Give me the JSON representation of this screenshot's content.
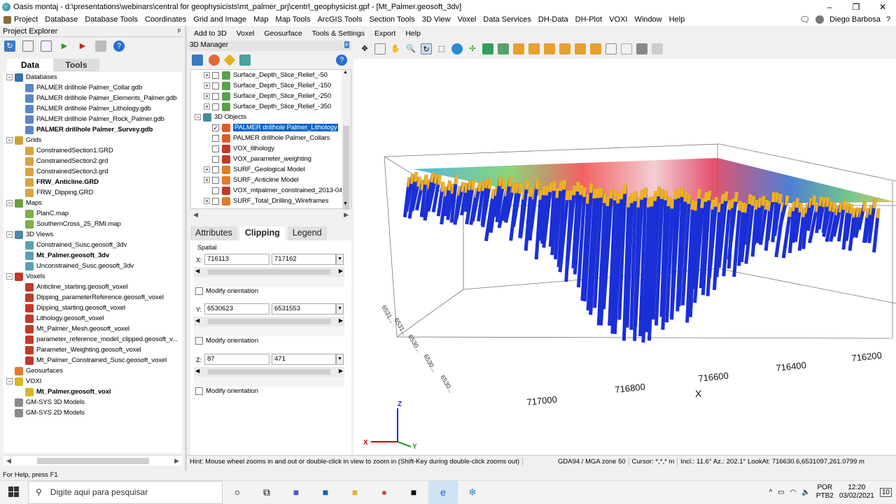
{
  "window": {
    "title": "Oasis montaj - d:\\presentations\\webinars\\central for geophysicists\\mt_palmer_prj\\centrl_geophysicist.gpf - [Mt_Palmer.geosoft_3dv]",
    "controls": [
      "–",
      "❐",
      "✕"
    ]
  },
  "menu": {
    "items": [
      "Project",
      "Database",
      "Database Tools",
      "Coordinates",
      "Grid and Image",
      "Map",
      "Map Tools",
      "ArcGIS Tools",
      "Section Tools",
      "3D View",
      "Voxel",
      "Data Services",
      "DH-Data",
      "DH-Plot",
      "VOXI",
      "Window",
      "Help"
    ],
    "user": "Diego Barbosa"
  },
  "project_explorer": {
    "title": "Project Explorer",
    "pin": "ᵖ",
    "tabs": [
      "Data",
      "Tools"
    ],
    "tree": [
      {
        "label": "Databases",
        "level": 0,
        "expander": "−",
        "bold": false,
        "icon": "database-folder-icon",
        "color": "#3a6fb0"
      },
      {
        "label": "PALMER drillhole Palmer_Collar.gdb",
        "level": 1,
        "bold": false,
        "icon": "database-icon",
        "color": "#5b87c7"
      },
      {
        "label": "PALMER drillhole Palmer_Elements_Palmer.gdb",
        "level": 1,
        "bold": false,
        "icon": "database-icon",
        "color": "#5b87c7"
      },
      {
        "label": "PALMER drillhole Palmer_Lithology.gdb",
        "level": 1,
        "bold": false,
        "icon": "database-icon",
        "color": "#5b87c7"
      },
      {
        "label": "PALMER drillhole Palmer_Rock_Palmer.gdb",
        "level": 1,
        "bold": false,
        "icon": "database-icon",
        "color": "#5b87c7"
      },
      {
        "label": "PALMER drillhole Palmer_Survey.gdb",
        "level": 1,
        "bold": true,
        "icon": "database-icon",
        "color": "#5b87c7"
      },
      {
        "label": "Grids",
        "level": 0,
        "expander": "−",
        "bold": false,
        "icon": "grid-folder-icon",
        "color": "#c8a23a"
      },
      {
        "label": "ConstrainedSection1.GRD",
        "level": 1,
        "bold": false,
        "icon": "grid-icon",
        "color": "#d9a441"
      },
      {
        "label": "ConstrainedSection2.grd",
        "level": 1,
        "bold": false,
        "icon": "grid-icon",
        "color": "#d9a441"
      },
      {
        "label": "ConstrainedSection3.grd",
        "level": 1,
        "bold": false,
        "icon": "grid-icon",
        "color": "#d9a441"
      },
      {
        "label": "FRW_Anticline.GRD",
        "level": 1,
        "bold": true,
        "icon": "grid-icon",
        "color": "#d9a441"
      },
      {
        "label": "FRW_Dipping.GRD",
        "level": 1,
        "bold": false,
        "icon": "grid-icon",
        "color": "#d9a441"
      },
      {
        "label": "Maps",
        "level": 0,
        "expander": "−",
        "bold": false,
        "icon": "map-folder-icon",
        "color": "#6a9f3a"
      },
      {
        "label": "PlanC.map",
        "level": 1,
        "bold": false,
        "icon": "map-icon",
        "color": "#7fae4a"
      },
      {
        "label": "SouthernCross_25_RMI.map",
        "level": 1,
        "bold": false,
        "icon": "map-icon",
        "color": "#7fae4a"
      },
      {
        "label": "3D Views",
        "level": 0,
        "expander": "−",
        "bold": false,
        "icon": "3d-view-folder-icon",
        "color": "#4a8aa0"
      },
      {
        "label": "Constrained_Susc.geosoft_3dv",
        "level": 1,
        "bold": false,
        "icon": "3d-view-icon",
        "color": "#5aa0b5"
      },
      {
        "label": "Mt_Palmer.geosoft_3dv",
        "level": 1,
        "bold": true,
        "icon": "3d-view-icon",
        "color": "#5aa0b5"
      },
      {
        "label": "Unconstrained_Susc.geosoft_3dv",
        "level": 1,
        "bold": false,
        "icon": "3d-view-icon",
        "color": "#5aa0b5"
      },
      {
        "label": "Voxels",
        "level": 0,
        "expander": "−",
        "bold": false,
        "icon": "voxel-folder-icon",
        "color": "#c0392b"
      },
      {
        "label": "Anticline_starting.geosoft_voxel",
        "level": 1,
        "bold": false,
        "icon": "voxel-icon",
        "color": "#c0392b"
      },
      {
        "label": "Dipping_parameterReference.geosoft_voxel",
        "level": 1,
        "bold": false,
        "icon": "voxel-icon",
        "color": "#c0392b"
      },
      {
        "label": "Dipping_starting.geosoft_voxel",
        "level": 1,
        "bold": false,
        "icon": "voxel-icon",
        "color": "#c0392b"
      },
      {
        "label": "Lithology.geosoft_voxel",
        "level": 1,
        "bold": false,
        "icon": "voxel-icon",
        "color": "#c0392b"
      },
      {
        "label": "Mt_Palmer_Mesh.geosoft_voxel",
        "level": 1,
        "bold": false,
        "icon": "voxel-icon",
        "color": "#c0392b"
      },
      {
        "label": "parameter_reference_model_clipped.geosoft_v...",
        "level": 1,
        "bold": false,
        "icon": "voxel-icon",
        "color": "#c0392b"
      },
      {
        "label": "Parameter_Weighting.geosoft_voxel",
        "level": 1,
        "bold": false,
        "icon": "voxel-icon",
        "color": "#c0392b"
      },
      {
        "label": "Mt_Palmer_Constrained_Susc.geosoft_voxel",
        "level": 1,
        "bold": false,
        "icon": "voxel-icon",
        "color": "#c0392b"
      },
      {
        "label": "Geosurfaces",
        "level": 0,
        "bold": false,
        "icon": "geosurface-icon",
        "color": "#e07b28"
      },
      {
        "label": "VOXI",
        "level": 0,
        "expander": "−",
        "bold": false,
        "icon": "voxi-folder-icon",
        "color": "#d4b820"
      },
      {
        "label": "Mt_Palmer.geosoft_voxi",
        "level": 1,
        "bold": true,
        "icon": "voxi-icon",
        "color": "#d4b820"
      },
      {
        "label": "GM-SYS 3D Models",
        "level": 0,
        "bold": false,
        "icon": "gmsys-3d-icon",
        "color": "#8a8a8a"
      },
      {
        "label": "GM-SYS 2D Models",
        "level": 0,
        "bold": false,
        "icon": "gmsys-2d-icon",
        "color": "#8a8a8a"
      }
    ],
    "hscroll_left": "◀",
    "hscroll_right": "▶"
  },
  "top_toolbar": {
    "items": [
      "Add to 3D",
      "Voxel",
      "Geosurface",
      "Tools & Settings",
      "Export",
      "Help"
    ]
  },
  "manager_3d": {
    "title": "3D Manager",
    "pin": "ᵖ",
    "tree": [
      {
        "label": "Surface_Depth_Slice_Relief_-50",
        "level": 1,
        "expander": "+",
        "checked": false,
        "selected": false,
        "icon": "surface-icon",
        "color": "#5aa04a"
      },
      {
        "label": "Surface_Depth_Slice_Relief_-150",
        "level": 1,
        "expander": "+",
        "checked": false,
        "selected": false,
        "icon": "surface-icon",
        "color": "#5aa04a"
      },
      {
        "label": "Surface_Depth_Slice_Relief_-250",
        "level": 1,
        "expander": "+",
        "checked": false,
        "selected": false,
        "icon": "surface-icon",
        "color": "#5aa04a"
      },
      {
        "label": "Surface_Depth_Slice_Relief_-350",
        "level": 1,
        "expander": "+",
        "checked": false,
        "selected": false,
        "icon": "surface-icon",
        "color": "#5aa04a"
      },
      {
        "label": "3D Objects",
        "level": 0,
        "expander": "−",
        "checked": null,
        "selected": false,
        "icon": "3d-objects-icon",
        "color": "#4a8aa0"
      },
      {
        "label": "PALMER drillhole Palmer_Lithology",
        "level": 1,
        "checked": true,
        "selected": true,
        "icon": "drillhole-icon",
        "color": "#e05a2a"
      },
      {
        "label": "PALMER drillhole Palmer_Collars",
        "level": 1,
        "checked": false,
        "selected": false,
        "icon": "drillhole-icon",
        "color": "#e05a2a"
      },
      {
        "label": "VOX_lithology",
        "level": 1,
        "checked": false,
        "selected": false,
        "icon": "voxel-icon",
        "color": "#c0392b"
      },
      {
        "label": "VOX_parameter_weighting",
        "level": 1,
        "checked": false,
        "selected": false,
        "icon": "voxel-icon",
        "color": "#c0392b"
      },
      {
        "label": "SURF_Geological Model",
        "level": 1,
        "expander": "+",
        "checked": false,
        "selected": false,
        "icon": "geosurface-icon",
        "color": "#e07b28"
      },
      {
        "label": "SURF_Anticline Model",
        "level": 1,
        "expander": "+",
        "checked": false,
        "selected": false,
        "icon": "geosurface-icon",
        "color": "#e07b28"
      },
      {
        "label": "VOX_mtpalmer_constrained_2013-04-2",
        "level": 1,
        "checked": false,
        "selected": false,
        "icon": "voxel-icon",
        "color": "#c0392b"
      },
      {
        "label": "SURF_Total_Drilling_Wireframes",
        "level": 1,
        "expander": "+",
        "checked": false,
        "selected": false,
        "icon": "geosurface-icon",
        "color": "#e07b28"
      }
    ],
    "scroll_up": "▲",
    "scroll_down": "▼",
    "scroll_left": "◀",
    "scroll_right": "▶"
  },
  "attributes_panel": {
    "tabs": [
      "Attributes",
      "Clipping",
      "Legend"
    ],
    "active_tab": "Clipping",
    "spatial_label": "Spatial",
    "x": {
      "label": "X:",
      "min": "716113",
      "max": "717162"
    },
    "y": {
      "label": "Y:",
      "min": "6530623",
      "max": "6531553"
    },
    "z": {
      "label": "Z:",
      "min": "87",
      "max": "471"
    },
    "modify_orientation": "Modify orientation",
    "slider_arrow_left": "◀",
    "slider_arrow_right": "▶"
  },
  "hint_bar": {
    "hint": "Hint: Mouse wheel zooms in and out or double-click in view to zoom in (Shift-Key during double-click zooms out)",
    "projection": "GDA94 / MGA zone 50",
    "cursor": "Cursor: *,*,* m",
    "view": "Incl.: 11.6° Az.: 202.1° LookAt: 716630.6,6531097,261.0799 m"
  },
  "viewport": {
    "x_ticks": [
      "717000",
      "716800",
      "716600",
      "716400",
      "716200"
    ],
    "x_axis_label": "X",
    "y_ticks": [
      "6531...",
      "6531...",
      "6530...",
      "6530...",
      "6530..."
    ],
    "triad_labels": {
      "z": "Z",
      "x": "X",
      "y": "Y"
    },
    "colors": {
      "drillhole_main": "#1a2fd6",
      "top_layer": "#f0b020"
    }
  },
  "status": {
    "text": "For Help, press F1"
  },
  "taskbar": {
    "search_placeholder": "Digite aqui para pesquisar",
    "lang": "POR",
    "lang2": "PTB2",
    "time": "12:20",
    "date": "03/02/2021",
    "notif": "10"
  }
}
